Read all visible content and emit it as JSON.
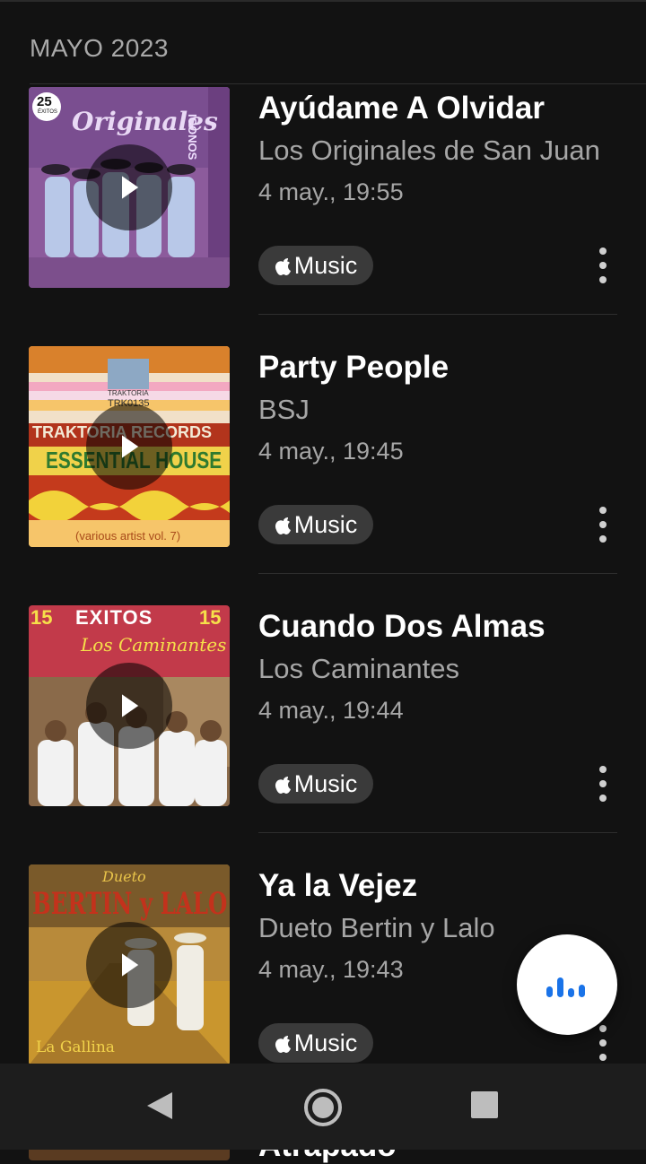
{
  "section": {
    "header": "MAYO 2023"
  },
  "items": [
    {
      "title": "Ayúdame A Olvidar",
      "artist": "Los Originales de San Juan",
      "time": "4 may., 19:55",
      "badge": "Music",
      "art": {
        "badge_num": "25",
        "badge_sub": "ÉXITOS",
        "logo": "Originales",
        "side": "ICONOS"
      }
    },
    {
      "title": "Party People",
      "artist": "BSJ",
      "time": "4 may., 19:45",
      "badge": "Music",
      "art": {
        "label1": "TRAKTORIA RECORDS",
        "label2": "ESSENTIAL HOUSE",
        "footer": "(various artist vol. 7)",
        "code": "TRK0135",
        "brand": "TRAKTORIA"
      }
    },
    {
      "title": "Cuando Dos Almas",
      "artist": "Los Caminantes",
      "time": "4 may., 19:44",
      "badge": "Music",
      "art": {
        "num_left": "15",
        "exitos": "EXITOS",
        "num_right": "15",
        "script": "Los Caminantes"
      }
    },
    {
      "title": "Ya la Vejez",
      "artist": "Dueto Bertin y Lalo",
      "time": "4 may., 19:43",
      "badge": "Music",
      "art": {
        "top": "Dueto",
        "main": "BERTIN y LALO",
        "footer": "La Gallina"
      }
    }
  ],
  "peek": {
    "title": "Atrapado"
  },
  "colors": {
    "background": "#121212",
    "accent": "#1a73e8",
    "badge_bg": "#3a3a3a"
  },
  "icons": {
    "play": "play-icon",
    "apple": "apple-icon",
    "more": "more-vertical-icon",
    "fab": "audio-bars-icon"
  }
}
